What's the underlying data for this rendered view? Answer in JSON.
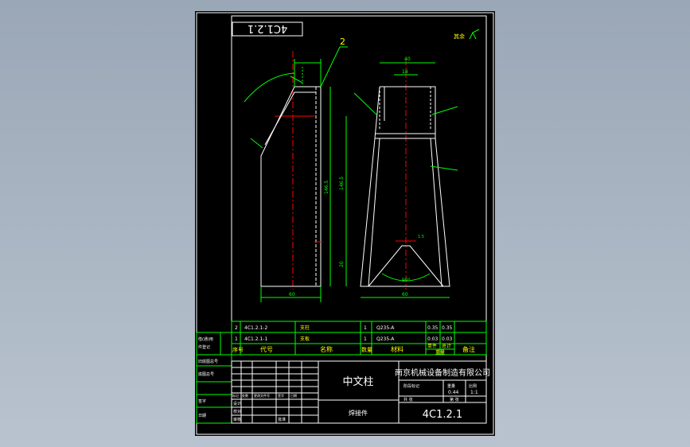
{
  "drawing_number": "4C1.2.1",
  "drawing_number_rotated": "4C1.2.1",
  "roughness_note": "其余",
  "balloon": "2",
  "dims": {
    "top_width": "40",
    "slot": "18",
    "bottom_width": "60",
    "bottom_width_right": "60",
    "left_height": "146.5",
    "left_height_right": "146.5",
    "lower_height": "20",
    "angle_bottom": "90°",
    "small_dim": "1.5"
  },
  "bom": {
    "rows": [
      {
        "seq": "2",
        "code": "4C1.2.1-2",
        "name": "支柱",
        "qty": "1",
        "material": "Q235-A",
        "unit_wt": "0.35",
        "total_wt": "0.35"
      },
      {
        "seq": "1",
        "code": "4C1.2.1-1",
        "name": "支板",
        "qty": "1",
        "material": "Q235-A",
        "unit_wt": "0.03",
        "total_wt": "0.03"
      }
    ],
    "header": {
      "seq": "序号",
      "code": "代号",
      "name": "名称",
      "qty": "数量",
      "material": "材料",
      "unit_wt": "单件",
      "total_wt": "总计",
      "weight": "重量",
      "remarks": "备注"
    }
  },
  "left_col": {
    "l1": "借(通)用",
    "l2": "件登记",
    "l3": "旧底图总号",
    "l4": "底图总号",
    "l5": "签字",
    "l6": "日期"
  },
  "title_block": {
    "part_name": "中文柱",
    "company": "南京机械设备制造有限公司",
    "note": "焊接件",
    "stage_label": "阶段标记",
    "weight_label": "重量",
    "scale_label": "比例",
    "weight_value": "0.44",
    "scale_value": "1:1",
    "sheet_label": "共 张",
    "sheet2_label": "第 张",
    "code": "4C1.2.1",
    "rev_labels": [
      "标记",
      "处数",
      "更改文件号",
      "签字",
      "日期"
    ],
    "sign_labels": [
      "设计",
      "校对",
      "审核",
      "批准"
    ],
    "date_label": "日期",
    "process_label": "工艺"
  }
}
